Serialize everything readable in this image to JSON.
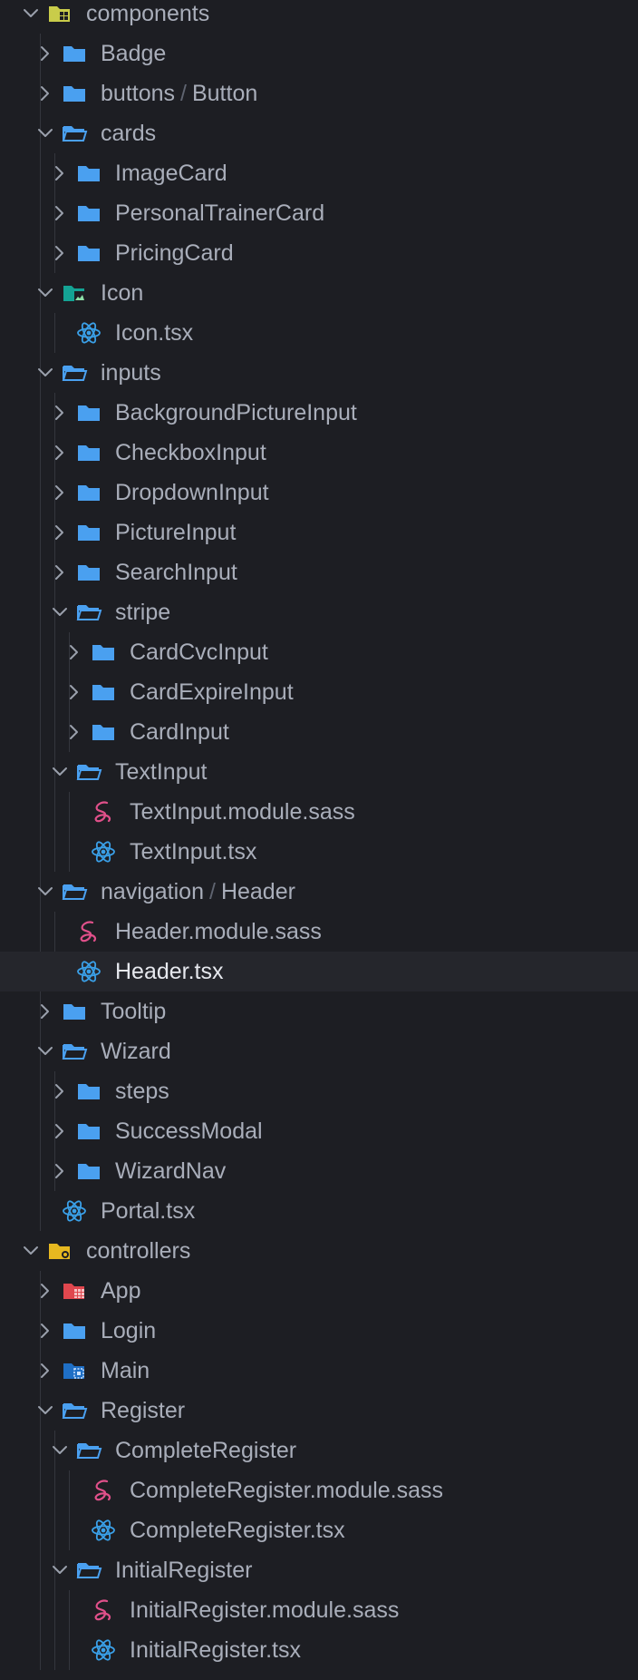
{
  "colors": {
    "background": "#1d1e23",
    "selected_row": "#25262c",
    "text": "#a9aeba",
    "selected_text": "#e6e8ee",
    "folder_blue": "#4aa0f0",
    "components_folder": "#c9cc4a",
    "controllers_folder": "#e6b820",
    "react_icon": "#3aa0e8",
    "sass_icon": "#e0508a"
  },
  "tree": [
    {
      "label": "components",
      "depth": 0,
      "kind": "folder",
      "icon": "folder-components-icon",
      "expanded": true
    },
    {
      "label": "Badge",
      "depth": 1,
      "kind": "folder",
      "icon": "folder-icon",
      "expanded": false
    },
    {
      "label": "buttons",
      "label_suffix": "Button",
      "depth": 1,
      "kind": "folder",
      "icon": "folder-icon",
      "expanded": false
    },
    {
      "label": "cards",
      "depth": 1,
      "kind": "folder",
      "icon": "folder-open-icon",
      "expanded": true
    },
    {
      "label": "ImageCard",
      "depth": 2,
      "kind": "folder",
      "icon": "folder-icon",
      "expanded": false
    },
    {
      "label": "PersonalTrainerCard",
      "depth": 2,
      "kind": "folder",
      "icon": "folder-icon",
      "expanded": false
    },
    {
      "label": "PricingCard",
      "depth": 2,
      "kind": "folder",
      "icon": "folder-icon",
      "expanded": false
    },
    {
      "label": "Icon",
      "depth": 1,
      "kind": "folder",
      "icon": "folder-images-icon",
      "expanded": true
    },
    {
      "label": "Icon.tsx",
      "depth": 2,
      "kind": "file",
      "icon": "react-icon"
    },
    {
      "label": "inputs",
      "depth": 1,
      "kind": "folder",
      "icon": "folder-open-icon",
      "expanded": true
    },
    {
      "label": "BackgroundPictureInput",
      "depth": 2,
      "kind": "folder",
      "icon": "folder-icon",
      "expanded": false
    },
    {
      "label": "CheckboxInput",
      "depth": 2,
      "kind": "folder",
      "icon": "folder-icon",
      "expanded": false
    },
    {
      "label": "DropdownInput",
      "depth": 2,
      "kind": "folder",
      "icon": "folder-icon",
      "expanded": false
    },
    {
      "label": "PictureInput",
      "depth": 2,
      "kind": "folder",
      "icon": "folder-icon",
      "expanded": false
    },
    {
      "label": "SearchInput",
      "depth": 2,
      "kind": "folder",
      "icon": "folder-icon",
      "expanded": false
    },
    {
      "label": "stripe",
      "depth": 2,
      "kind": "folder",
      "icon": "folder-open-icon",
      "expanded": true
    },
    {
      "label": "CardCvcInput",
      "depth": 3,
      "kind": "folder",
      "icon": "folder-icon",
      "expanded": false
    },
    {
      "label": "CardExpireInput",
      "depth": 3,
      "kind": "folder",
      "icon": "folder-icon",
      "expanded": false
    },
    {
      "label": "CardInput",
      "depth": 3,
      "kind": "folder",
      "icon": "folder-icon",
      "expanded": false
    },
    {
      "label": "TextInput",
      "depth": 2,
      "kind": "folder",
      "icon": "folder-open-icon",
      "expanded": true
    },
    {
      "label": "TextInput.module.sass",
      "depth": 3,
      "kind": "file",
      "icon": "sass-icon"
    },
    {
      "label": "TextInput.tsx",
      "depth": 3,
      "kind": "file",
      "icon": "react-icon"
    },
    {
      "label": "navigation",
      "label_suffix": "Header",
      "depth": 1,
      "kind": "folder",
      "icon": "folder-open-icon",
      "expanded": true
    },
    {
      "label": "Header.module.sass",
      "depth": 2,
      "kind": "file",
      "icon": "sass-icon"
    },
    {
      "label": "Header.tsx",
      "depth": 2,
      "kind": "file",
      "icon": "react-icon",
      "selected": true
    },
    {
      "label": "Tooltip",
      "depth": 1,
      "kind": "folder",
      "icon": "folder-icon",
      "expanded": false
    },
    {
      "label": "Wizard",
      "depth": 1,
      "kind": "folder",
      "icon": "folder-open-icon",
      "expanded": true
    },
    {
      "label": "steps",
      "depth": 2,
      "kind": "folder",
      "icon": "folder-icon",
      "expanded": false
    },
    {
      "label": "SuccessModal",
      "depth": 2,
      "kind": "folder",
      "icon": "folder-icon",
      "expanded": false
    },
    {
      "label": "WizardNav",
      "depth": 2,
      "kind": "folder",
      "icon": "folder-icon",
      "expanded": false
    },
    {
      "label": "Portal.tsx",
      "depth": 1,
      "kind": "file",
      "icon": "react-icon"
    },
    {
      "label": "controllers",
      "depth": 0,
      "kind": "folder",
      "icon": "folder-controllers-icon",
      "expanded": true
    },
    {
      "label": "App",
      "depth": 1,
      "kind": "folder",
      "icon": "folder-app-icon",
      "expanded": false
    },
    {
      "label": "Login",
      "depth": 1,
      "kind": "folder",
      "icon": "folder-icon",
      "expanded": false
    },
    {
      "label": "Main",
      "depth": 1,
      "kind": "folder",
      "icon": "folder-main-icon",
      "expanded": false
    },
    {
      "label": "Register",
      "depth": 1,
      "kind": "folder",
      "icon": "folder-open-icon",
      "expanded": true
    },
    {
      "label": "CompleteRegister",
      "depth": 2,
      "kind": "folder",
      "icon": "folder-open-icon",
      "expanded": true
    },
    {
      "label": "CompleteRegister.module.sass",
      "depth": 3,
      "kind": "file",
      "icon": "sass-icon"
    },
    {
      "label": "CompleteRegister.tsx",
      "depth": 3,
      "kind": "file",
      "icon": "react-icon"
    },
    {
      "label": "InitialRegister",
      "depth": 2,
      "kind": "folder",
      "icon": "folder-open-icon",
      "expanded": true
    },
    {
      "label": "InitialRegister.module.sass",
      "depth": 3,
      "kind": "file",
      "icon": "sass-icon"
    },
    {
      "label": "InitialRegister.tsx",
      "depth": 3,
      "kind": "file",
      "icon": "react-icon"
    }
  ]
}
